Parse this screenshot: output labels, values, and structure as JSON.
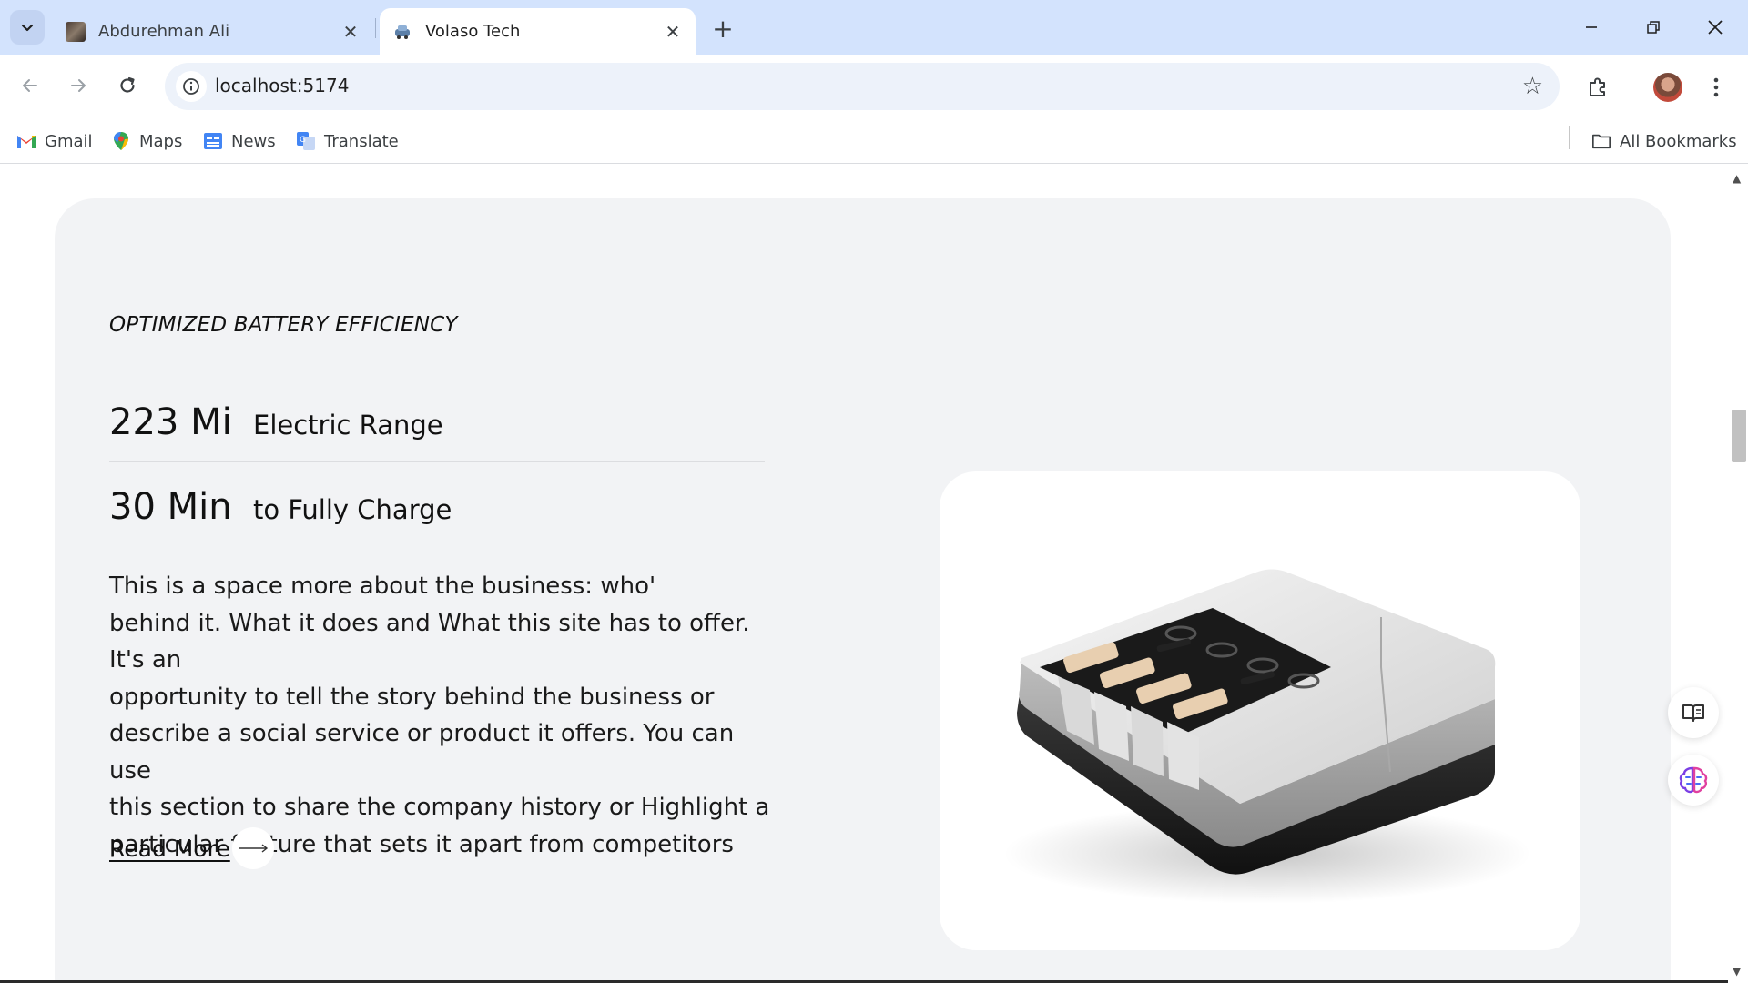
{
  "browser": {
    "tabs": [
      {
        "title": "Abdurehman Ali",
        "active": false
      },
      {
        "title": "Volaso Tech",
        "active": true
      }
    ],
    "url": "localhost:5174",
    "bookmarks": [
      {
        "label": "Gmail",
        "icon": "gmail-icon"
      },
      {
        "label": "Maps",
        "icon": "maps-icon"
      },
      {
        "label": "News",
        "icon": "news-icon"
      },
      {
        "label": "Translate",
        "icon": "translate-icon"
      }
    ],
    "all_bookmarks_label": "All Bookmarks"
  },
  "section": {
    "eyebrow": "OPTIMIZED BATTERY EFFICIENCY",
    "stats": [
      {
        "value": "223 Mi",
        "label": "Electric Range"
      },
      {
        "value": "30 Min",
        "label": "to Fully Charge"
      }
    ],
    "description": [
      "This is a space more about the business: who'",
      "behind it. What it does and What this site has to offer. It's an",
      "opportunity to tell the story behind the business or",
      "describe a social service or product it offers. You can use",
      "this section to share the company history or Highlight a",
      "particular feature that sets it apart from competitors"
    ],
    "read_more_label": "Read More",
    "image_icon": "battery-pack-image"
  },
  "colors": {
    "tabstrip": "#d3e3fd",
    "card_background": "#f2f3f5",
    "omnibox": "#edf2fa"
  }
}
